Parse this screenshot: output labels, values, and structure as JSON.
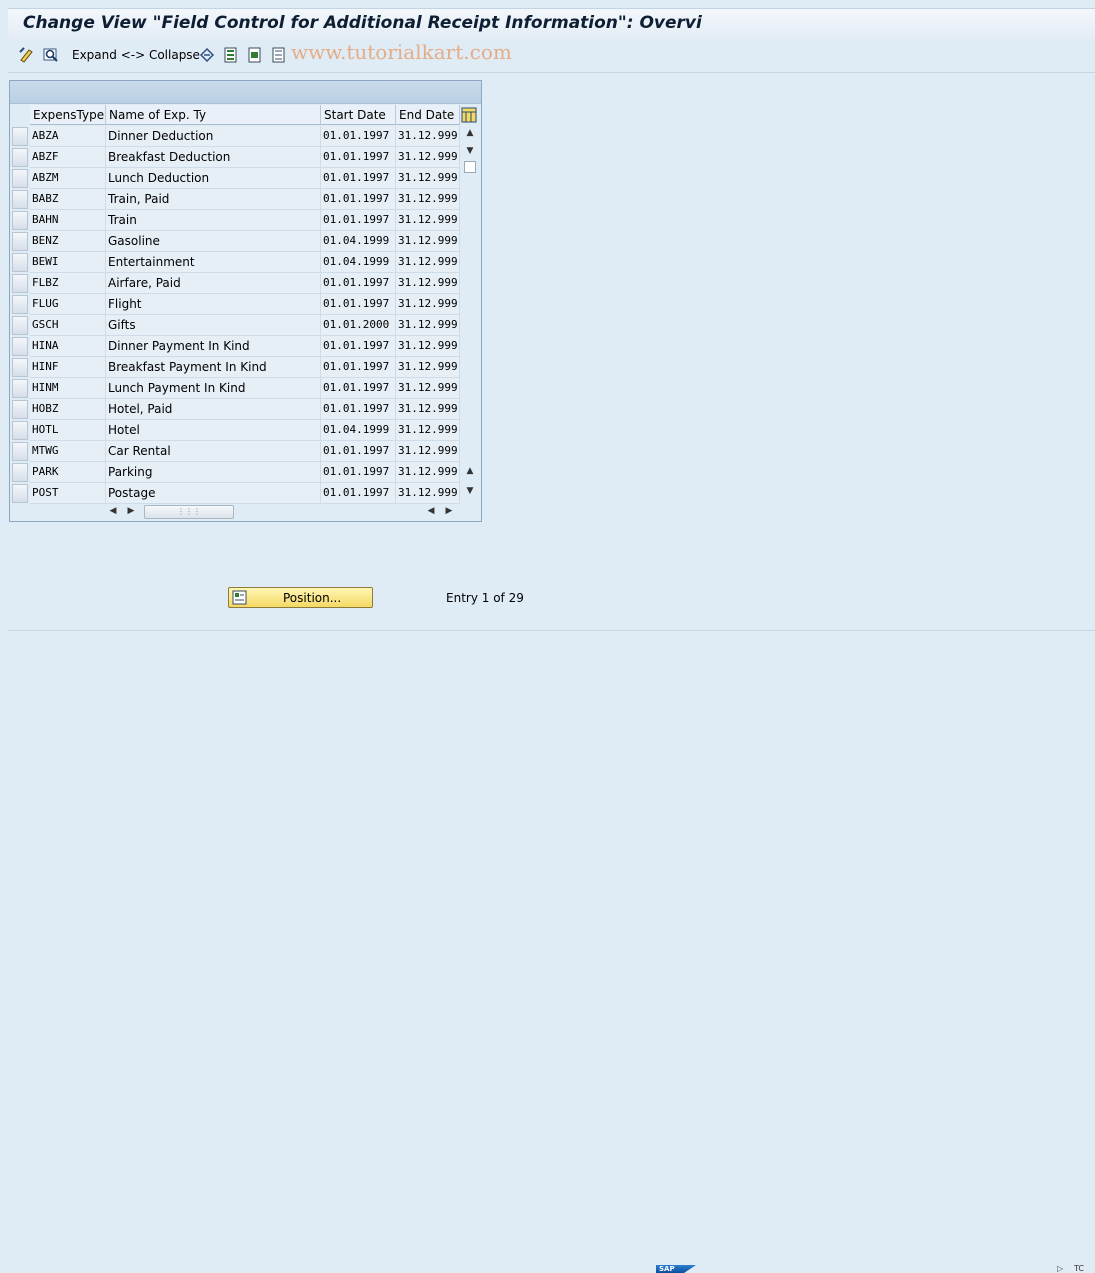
{
  "title": "Change View \"Field Control for Additional Receipt Information\": Overvi",
  "toolbar": {
    "expand_collapse_label": "Expand <-> Collapse",
    "watermark": "www.tutorialkart.com",
    "icons": [
      "display-change-icon",
      "find-icon",
      "undo-icon",
      "select-all-icon",
      "select-block-icon",
      "deselect-all-icon"
    ]
  },
  "table": {
    "columns": [
      "ExpensType",
      "Name of Exp. Ty",
      "Start Date",
      "End Date"
    ],
    "rows": [
      {
        "type": "ABZA",
        "name": "Dinner Deduction",
        "start": "01.01.1997",
        "end": "31.12.999"
      },
      {
        "type": "ABZF",
        "name": "Breakfast Deduction",
        "start": "01.01.1997",
        "end": "31.12.999"
      },
      {
        "type": "ABZM",
        "name": "Lunch Deduction",
        "start": "01.01.1997",
        "end": "31.12.999"
      },
      {
        "type": "BABZ",
        "name": "Train, Paid",
        "start": "01.01.1997",
        "end": "31.12.999"
      },
      {
        "type": "BAHN",
        "name": "Train",
        "start": "01.01.1997",
        "end": "31.12.999"
      },
      {
        "type": "BENZ",
        "name": "Gasoline",
        "start": "01.04.1999",
        "end": "31.12.999"
      },
      {
        "type": "BEWI",
        "name": "Entertainment",
        "start": "01.04.1999",
        "end": "31.12.999"
      },
      {
        "type": "FLBZ",
        "name": "Airfare, Paid",
        "start": "01.01.1997",
        "end": "31.12.999"
      },
      {
        "type": "FLUG",
        "name": "Flight",
        "start": "01.01.1997",
        "end": "31.12.999"
      },
      {
        "type": "GSCH",
        "name": "Gifts",
        "start": "01.01.2000",
        "end": "31.12.999"
      },
      {
        "type": "HINA",
        "name": "Dinner Payment In Kind",
        "start": "01.01.1997",
        "end": "31.12.999"
      },
      {
        "type": "HINF",
        "name": "Breakfast Payment In Kind",
        "start": "01.01.1997",
        "end": "31.12.999"
      },
      {
        "type": "HINM",
        "name": "Lunch Payment In Kind",
        "start": "01.01.1997",
        "end": "31.12.999"
      },
      {
        "type": "HOBZ",
        "name": "Hotel, Paid",
        "start": "01.01.1997",
        "end": "31.12.999"
      },
      {
        "type": "HOTL",
        "name": "Hotel",
        "start": "01.04.1999",
        "end": "31.12.999"
      },
      {
        "type": "MTWG",
        "name": "Car Rental",
        "start": "01.01.1997",
        "end": "31.12.999"
      },
      {
        "type": "PARK",
        "name": "Parking",
        "start": "01.01.1997",
        "end": "31.12.999"
      },
      {
        "type": "POST",
        "name": "Postage",
        "start": "01.01.1997",
        "end": "31.12.999"
      }
    ]
  },
  "position_button": {
    "label": "Position..."
  },
  "entry_info": "Entry 1 of 29",
  "footer": {
    "logo_text": "SAP",
    "status_text": "TC"
  },
  "colors": {
    "background": "#dfebf5",
    "position_button": "#f5d964",
    "watermark": "#e6a77a"
  }
}
